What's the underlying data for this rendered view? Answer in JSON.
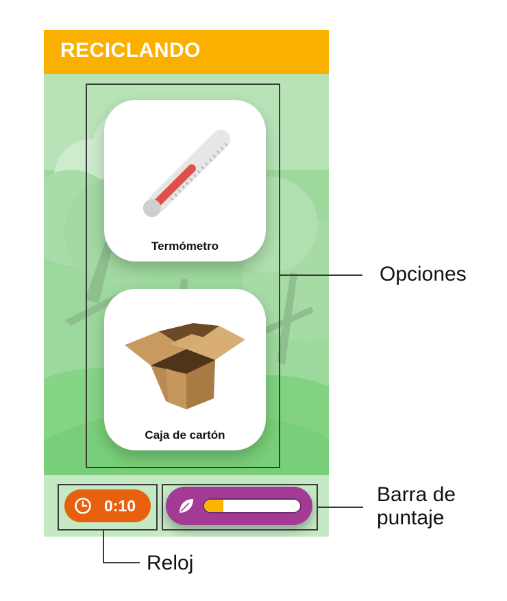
{
  "app": {
    "title": "RECICLANDO",
    "colors": {
      "header": "#fbb000",
      "timer": "#e8600e",
      "score": "#a33b96",
      "score_fill": "#fbb400"
    }
  },
  "options": [
    {
      "label": "Termómetro",
      "icon": "thermometer-icon"
    },
    {
      "label": "Caja de cartón",
      "icon": "cardboard-box-icon"
    }
  ],
  "timer": {
    "value": "0:10",
    "icon": "clock-icon"
  },
  "score": {
    "icon": "leaf-icon",
    "fraction": 0.2
  },
  "annotations": {
    "opciones": "Opciones",
    "barra_line1": "Barra de",
    "barra_line2": "puntaje",
    "reloj": "Reloj"
  }
}
